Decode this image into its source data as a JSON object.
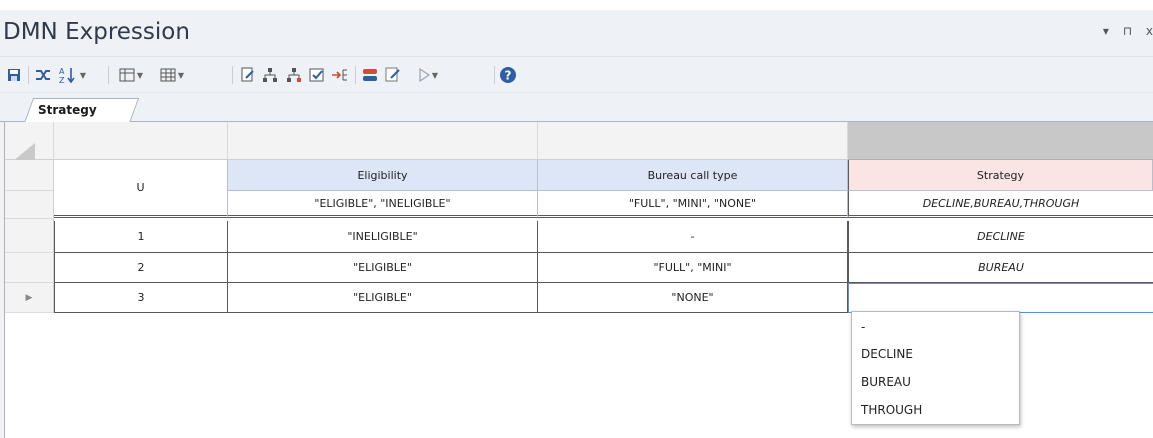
{
  "window": {
    "title": "DMN Expression",
    "controls": [
      "▾",
      "⊓",
      "x"
    ]
  },
  "toolbar": {
    "icons": [
      "save-icon",
      "shuffle-icon",
      "sort-az-icon",
      "table-columns-icon",
      "table-grid-icon",
      "edit-doc-icon",
      "hierarchy-icon",
      "hierarchy2-icon",
      "checkbox-icon",
      "insert-arrow-icon",
      "rules-icon",
      "validate-icon",
      "play-icon",
      "help-icon"
    ]
  },
  "tabs": [
    {
      "label": "Strategy",
      "active": true
    }
  ],
  "table": {
    "hit_policy": "U",
    "inputs": [
      {
        "label": "Eligibility",
        "allowed": "\"ELIGIBLE\", \"INELIGIBLE\""
      },
      {
        "label": "Bureau call type",
        "allowed": "\"FULL\", \"MINI\", \"NONE\""
      }
    ],
    "output": {
      "label": "Strategy",
      "allowed": "DECLINE,BUREAU,THROUGH"
    },
    "rows": [
      {
        "num": "1",
        "eligibility": "\"INELIGIBLE\"",
        "bureau": "-",
        "strategy": "DECLINE"
      },
      {
        "num": "2",
        "eligibility": "\"ELIGIBLE\"",
        "bureau": "\"FULL\", \"MINI\"",
        "strategy": "BUREAU"
      },
      {
        "num": "3",
        "eligibility": "\"ELIGIBLE\"",
        "bureau": "\"NONE\"",
        "strategy": ""
      }
    ],
    "current_row_marker": "▶"
  },
  "dropdown": {
    "options": [
      "-",
      "DECLINE",
      "BUREAU",
      "THROUGH"
    ]
  },
  "colors": {
    "input_header": "#dce6f7",
    "output_header": "#fbe4e4",
    "accent": "#2e5fa3"
  }
}
